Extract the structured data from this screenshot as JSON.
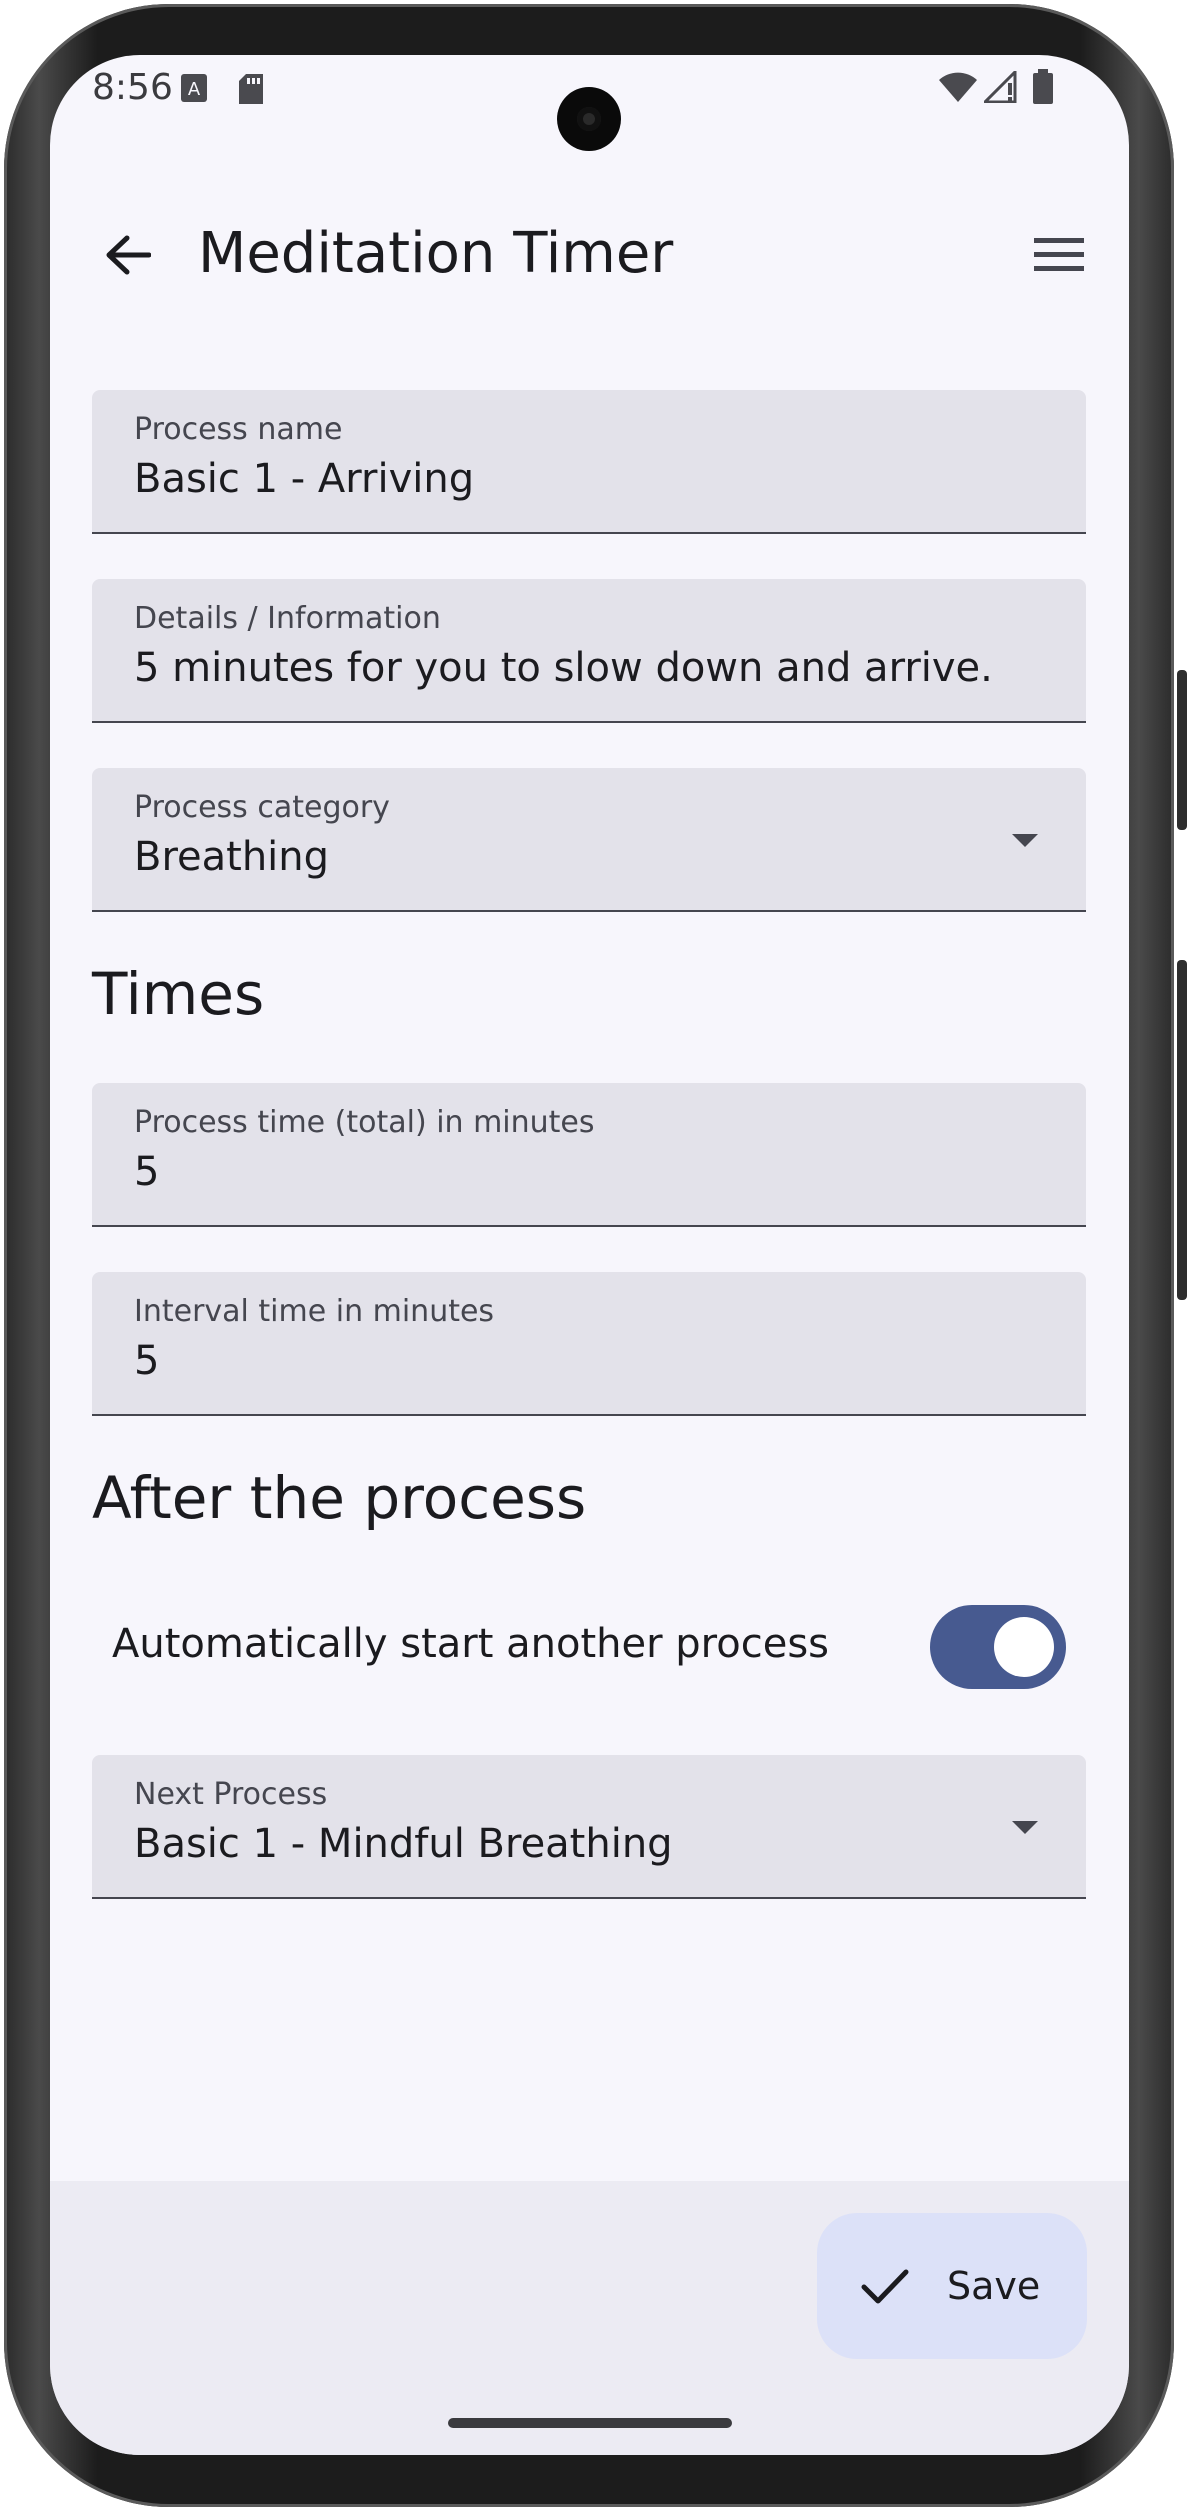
{
  "status_bar": {
    "time": "8:56"
  },
  "app_bar": {
    "title": "Meditation Timer"
  },
  "form": {
    "process_name": {
      "label": "Process name",
      "value": "Basic 1 - Arriving"
    },
    "details": {
      "label": "Details / Information",
      "value": "5 minutes for you to slow down and arrive."
    },
    "category": {
      "label": "Process category",
      "value": "Breathing"
    },
    "times_heading": "Times",
    "process_time": {
      "label": "Process time (total) in minutes",
      "value": "5"
    },
    "interval_time": {
      "label": "Interval time in minutes",
      "value": "5"
    },
    "after_heading": "After the process",
    "auto_start": {
      "label": "Automatically start another process",
      "checked": true
    },
    "next_process": {
      "label": "Next Process",
      "value": "Basic 1 - Mindful Breathing"
    }
  },
  "actions": {
    "save_label": "Save"
  },
  "colors": {
    "accent": "#475a90",
    "field_bg": "#e3e2ea",
    "fab_bg": "#dce1f8",
    "background": "#f7f6fc"
  }
}
